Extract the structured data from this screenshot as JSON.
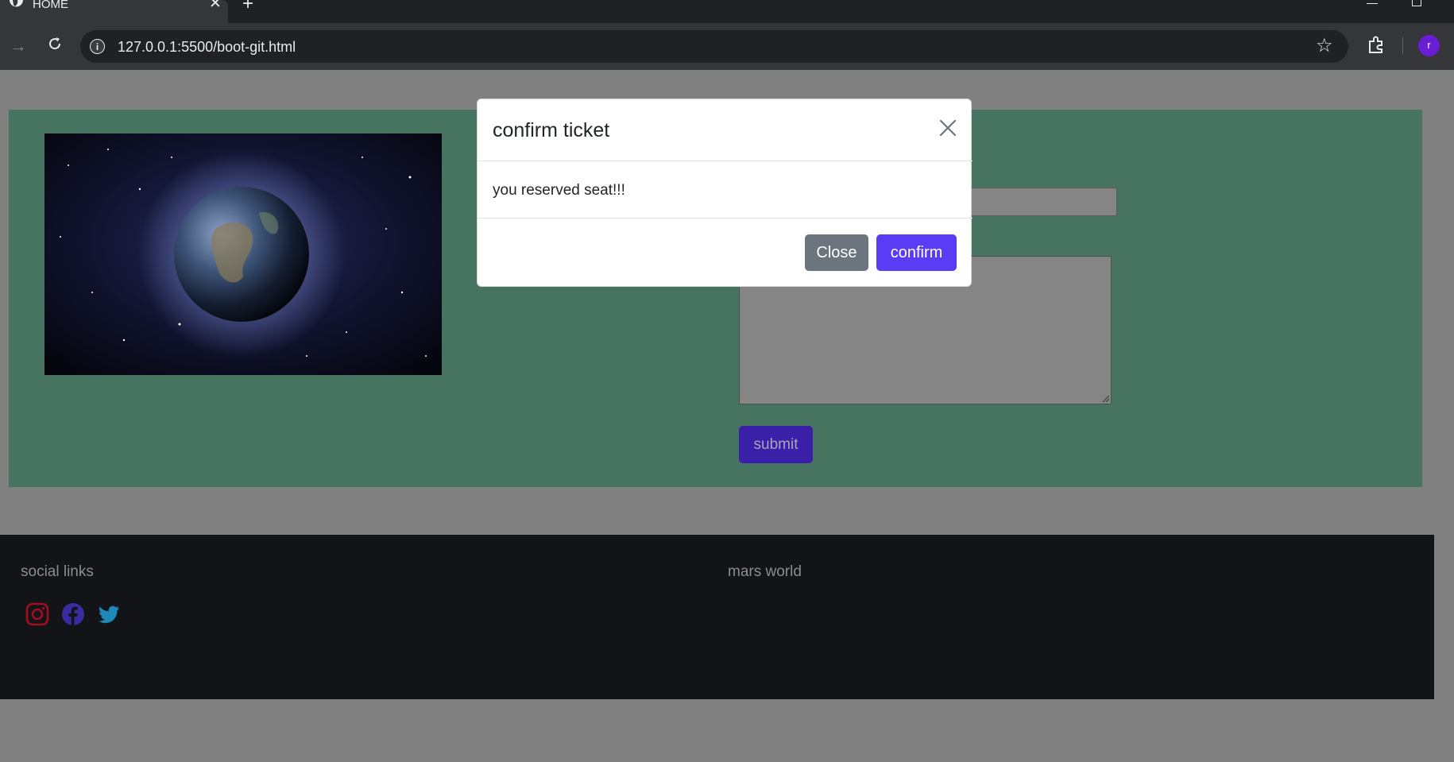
{
  "browser": {
    "tab_title": "HOME",
    "url": "127.0.0.1:5500/boot-git.html",
    "profile_initial": "r"
  },
  "modal": {
    "title": "confirm ticket",
    "body": "you reserved seat!!!",
    "close_label": "Close",
    "confirm_label": "confirm"
  },
  "form": {
    "submit_label": "submit"
  },
  "footer": {
    "social_title": "social links",
    "mars_title": "mars world",
    "social_icons": [
      "instagram-icon",
      "facebook-icon",
      "twitter-icon"
    ]
  },
  "colors": {
    "hero_bg": "#467461",
    "footer_bg": "#131418",
    "overlay": "#808080",
    "confirm_btn": "#5b3cf5",
    "close_btn": "#6c757d",
    "submit_btn": "#3a1fa8"
  }
}
